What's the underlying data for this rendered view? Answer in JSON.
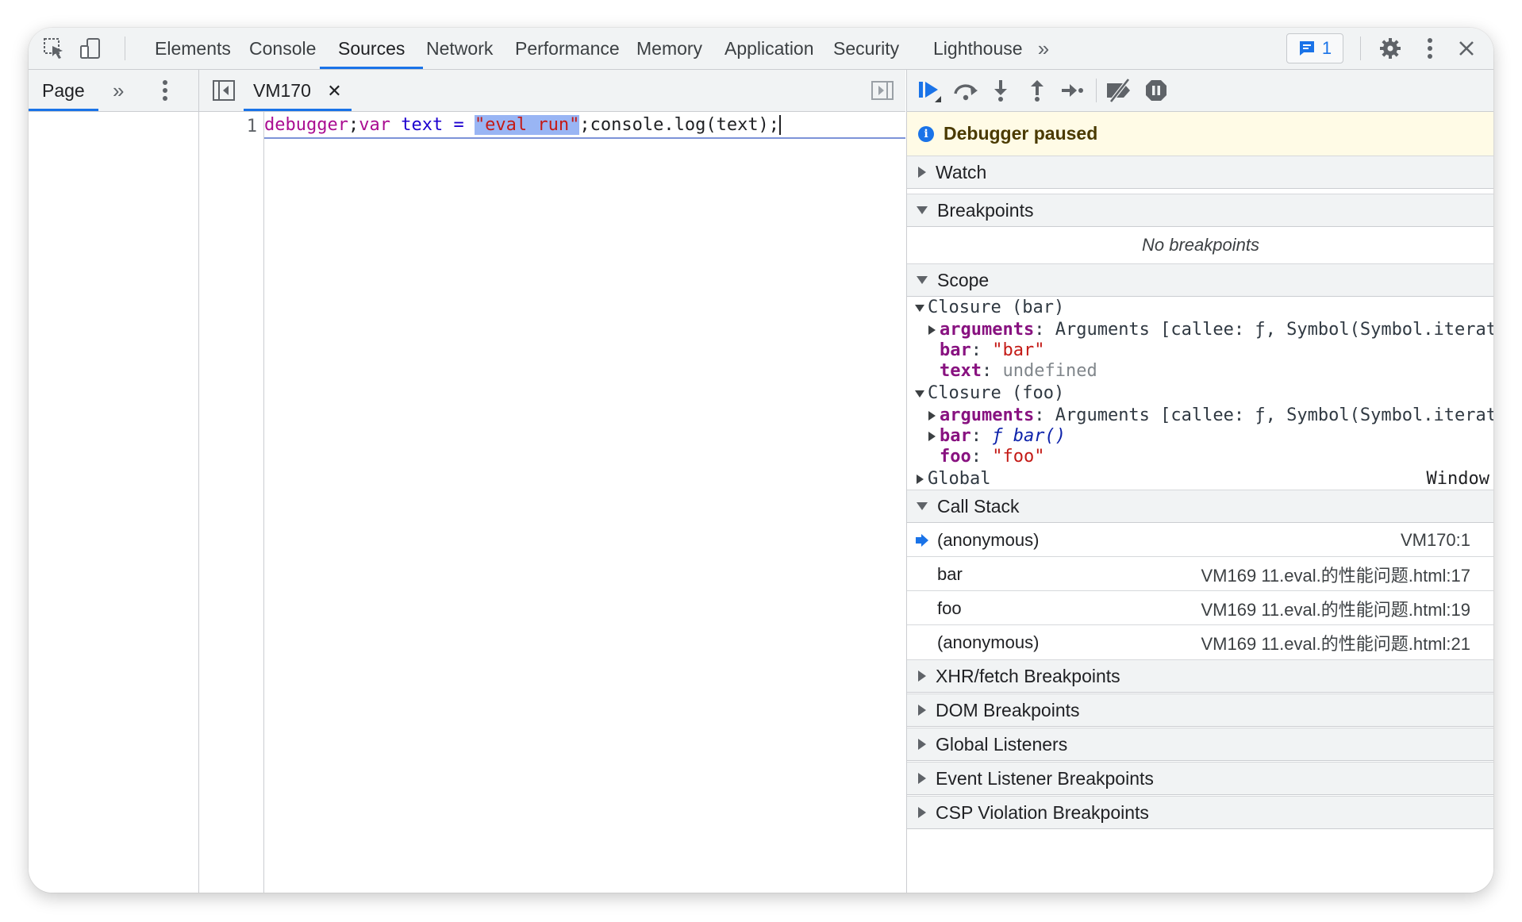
{
  "toolbar": {
    "tabs": [
      "Elements",
      "Console",
      "Sources",
      "Network",
      "Performance",
      "Memory",
      "Application",
      "Security",
      "Lighthouse"
    ],
    "active_tab": "Sources",
    "messages_count": "1"
  },
  "navigator": {
    "tab": "Page"
  },
  "editor": {
    "file_tab": "VM170",
    "line_number": "1",
    "code": {
      "t1": "debugger",
      "t2": ";",
      "t3": "var",
      "t4": " text = ",
      "t5": "\"eval run\"",
      "t6": ";console.log(text);"
    }
  },
  "debugger": {
    "paused_text": "Debugger paused",
    "sections": {
      "watch": "Watch",
      "breakpoints": "Breakpoints",
      "scope": "Scope",
      "call_stack": "Call Stack",
      "xhr": "XHR/fetch Breakpoints",
      "dom": "DOM Breakpoints",
      "global_listeners": "Global Listeners",
      "event_listener": "Event Listener Breakpoints",
      "csp": "CSP Violation Breakpoints"
    },
    "no_breakpoints": "No breakpoints",
    "scope": {
      "closure_bar": "Closure (bar)",
      "closure_foo": "Closure (foo)",
      "global": "Global",
      "global_value": "Window",
      "arguments_label": "arguments",
      "arguments_value": "Arguments [callee: ƒ, Symbol(Symbol.iterator): ƒ]",
      "bar_label": "bar",
      "bar_value": "\"bar\"",
      "text_label": "text",
      "text_value": "undefined",
      "bar_fn_label": "bar",
      "bar_fn_value": "ƒ bar()",
      "foo_label": "foo",
      "foo_value": "\"foo\""
    },
    "call_stack": [
      {
        "fn": "(anonymous)",
        "loc": "VM170:1"
      },
      {
        "fn": "bar",
        "loc": "VM169 11.eval.的性能问题.html:17"
      },
      {
        "fn": "foo",
        "loc": "VM169 11.eval.的性能问题.html:19"
      },
      {
        "fn": "(anonymous)",
        "loc": "VM169 11.eval.的性能问题.html:21"
      }
    ]
  }
}
